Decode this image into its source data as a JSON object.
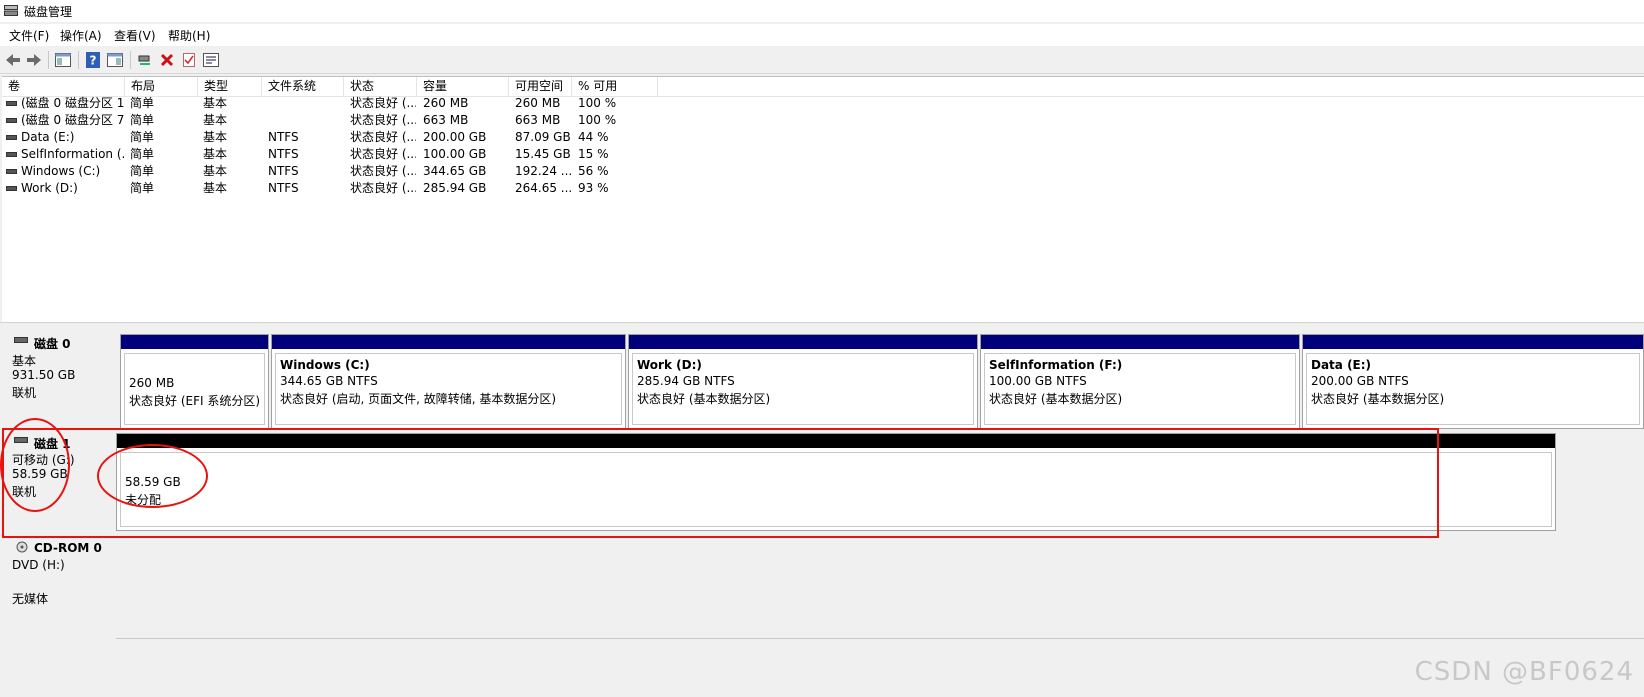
{
  "window": {
    "title": "磁盘管理"
  },
  "menu": [
    {
      "label": "文件(F)"
    },
    {
      "label": "操作(A)"
    },
    {
      "label": "查看(V)"
    },
    {
      "label": "帮助(H)"
    }
  ],
  "toolbar": {
    "buttons": [
      "back-icon",
      "forward-icon",
      "console-tree-icon",
      "help-icon",
      "properties-icon",
      "connect-icon",
      "delete-icon",
      "check-icon",
      "settings-icon"
    ]
  },
  "volume_list": {
    "columns": [
      "卷",
      "布局",
      "类型",
      "文件系统",
      "状态",
      "容量",
      "可用空间",
      "% 可用"
    ],
    "rows": [
      {
        "vol": "(磁盘 0 磁盘分区 1)",
        "layout": "简单",
        "type": "基本",
        "fs": "",
        "status": "状态良好 (...",
        "capacity": "260 MB",
        "free": "260 MB",
        "pct": "100 %"
      },
      {
        "vol": "(磁盘 0 磁盘分区 7)",
        "layout": "简单",
        "type": "基本",
        "fs": "",
        "status": "状态良好 (...",
        "capacity": "663 MB",
        "free": "663 MB",
        "pct": "100 %"
      },
      {
        "vol": "Data (E:)",
        "layout": "简单",
        "type": "基本",
        "fs": "NTFS",
        "status": "状态良好 (...",
        "capacity": "200.00 GB",
        "free": "87.09 GB",
        "pct": "44 %"
      },
      {
        "vol": "SelfInformation (...",
        "layout": "简单",
        "type": "基本",
        "fs": "NTFS",
        "status": "状态良好 (...",
        "capacity": "100.00 GB",
        "free": "15.45 GB",
        "pct": "15 %"
      },
      {
        "vol": "Windows (C:)",
        "layout": "简单",
        "type": "基本",
        "fs": "NTFS",
        "status": "状态良好 (...",
        "capacity": "344.65 GB",
        "free": "192.24 ...",
        "pct": "56 %"
      },
      {
        "vol": "Work (D:)",
        "layout": "简单",
        "type": "基本",
        "fs": "NTFS",
        "status": "状态良好 (...",
        "capacity": "285.94 GB",
        "free": "264.65 ...",
        "pct": "93 %"
      }
    ]
  },
  "disks": [
    {
      "name": "磁盘 0",
      "kind": "基本",
      "size": "931.50 GB",
      "state": "联机",
      "partitions": [
        {
          "title": "",
          "line1": "260 MB",
          "line2": "状态良好 (EFI 系统分区)"
        },
        {
          "title": "Windows (C:)",
          "line1": "344.65 GB NTFS",
          "line2": "状态良好 (启动, 页面文件, 故障转储, 基本数据分区)"
        },
        {
          "title": "Work (D:)",
          "line1": "285.94 GB NTFS",
          "line2": "状态良好 (基本数据分区)"
        },
        {
          "title": "SelfInformation (F:)",
          "line1": "100.00 GB NTFS",
          "line2": "状态良好 (基本数据分区)"
        },
        {
          "title": "Data (E:)",
          "line1": "200.00 GB NTFS",
          "line2": "状态良好 (基本数据分区)"
        }
      ]
    },
    {
      "name": "磁盘 1",
      "kind": "可移动 (G:)",
      "size": "58.59 GB",
      "state": "联机",
      "partitions": [
        {
          "title": "",
          "line1": "58.59 GB",
          "line2": "未分配"
        }
      ]
    },
    {
      "name": "CD-ROM 0",
      "kind": "DVD (H:)",
      "size": "",
      "state": "无媒体"
    }
  ],
  "watermark": "CSDN @BF0624",
  "colors": {
    "partition_bar": "#00007a",
    "unallocated_bar": "#000000",
    "annotation": "#e8130f"
  }
}
